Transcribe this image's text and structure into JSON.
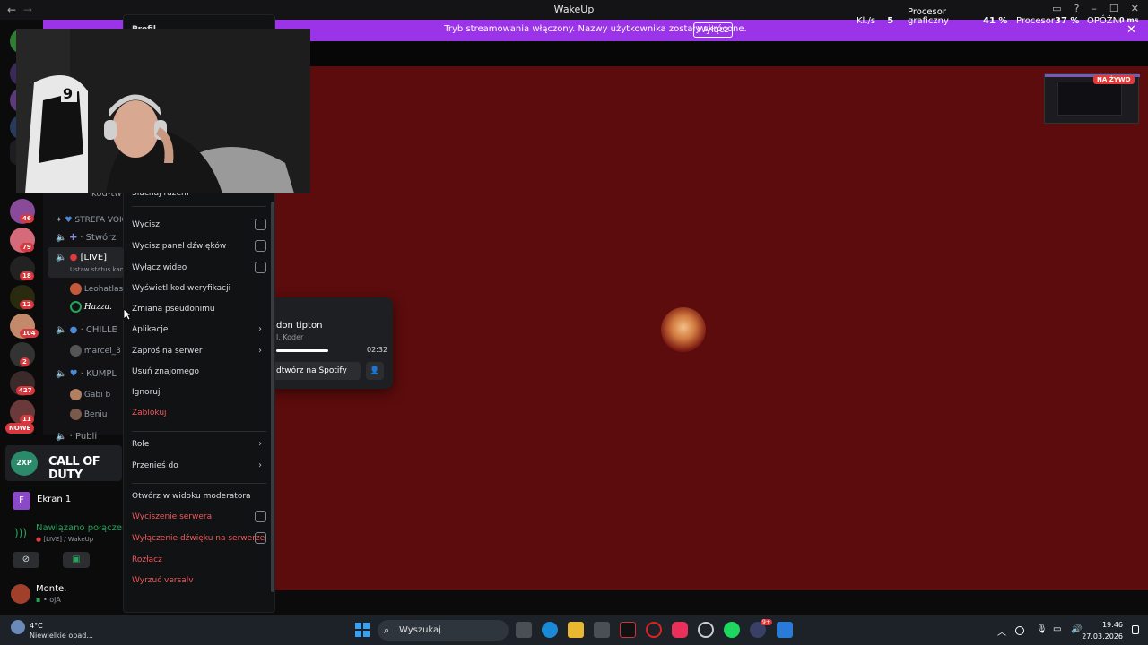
{
  "window": {
    "title": "WakeUp",
    "back": "←",
    "forward": "→",
    "minimize": "–",
    "maximize": "☐",
    "close": "✕",
    "help": "?"
  },
  "banner": {
    "text": "Tryb streamowania włączony. Nazwy użytkownika zostały skrócone.",
    "button": "Wyłącz",
    "close": "✕",
    "stats": {
      "fps_label": "Kl./s",
      "fps_value": "5",
      "gpu_label_1": "Procesor",
      "gpu_label_2": "graficzny",
      "gpu_value": "41 %",
      "cpu_label": "Procesor",
      "cpu_value": "37 %",
      "latency_label": "OPÓŹN.",
      "latency_value": "0 ms"
    }
  },
  "rail": {
    "badges": [
      "46",
      "79",
      "18",
      "12",
      "104",
      "2",
      "427",
      "11"
    ],
    "new_label": "NOWE"
  },
  "channels": {
    "items": [
      {
        "text": "kod-tw",
        "type": "text"
      },
      {
        "text": "STREFA VOICE",
        "type": "category"
      },
      {
        "text": "· Stwórz",
        "type": "voice"
      },
      {
        "text": "[LIVE]",
        "type": "voice-active"
      },
      {
        "text": "Ustaw status kan",
        "type": "sub"
      },
      {
        "text": "Leohatlas",
        "type": "member"
      },
      {
        "text": "Hazza.",
        "type": "member"
      },
      {
        "text": "· CHILLE",
        "type": "voice"
      },
      {
        "text": "marcel_3",
        "type": "member"
      },
      {
        "text": "· KUMPL",
        "type": "voice"
      },
      {
        "text": "Gabi b",
        "type": "member"
      },
      {
        "text": "Beniu",
        "type": "member"
      },
      {
        "text": "· Publi",
        "type": "voice"
      }
    ]
  },
  "game": {
    "name": "CALL OF DUTY",
    "badge": "2XP"
  },
  "screen_share": {
    "icon_letter": "F",
    "label": "Ekran 1"
  },
  "voice_status": {
    "title": "Nawiązano połączenie",
    "subtitle": "[LIVE] / WakeUp"
  },
  "user": {
    "name": "Monte.",
    "status": "ojA"
  },
  "context_menu": {
    "top_label": "Profil",
    "items": [
      {
        "label": "Słuchaj razem",
        "style": "normal",
        "control": "none"
      },
      {
        "label": "Wycisz",
        "style": "normal",
        "control": "checkbox"
      },
      {
        "label": "Wycisz panel dźwięków",
        "style": "normal",
        "control": "checkbox"
      },
      {
        "label": "Wyłącz wideo",
        "style": "normal",
        "control": "checkbox"
      },
      {
        "label": "Wyświetl kod weryfikacji",
        "style": "normal",
        "control": "none"
      },
      {
        "label": "Zmiana pseudonimu",
        "style": "normal",
        "control": "none"
      },
      {
        "label": "Aplikacje",
        "style": "normal",
        "control": "submenu"
      },
      {
        "label": "Zaproś na serwer",
        "style": "normal",
        "control": "submenu"
      },
      {
        "label": "Usuń znajomego",
        "style": "normal",
        "control": "none"
      },
      {
        "label": "Ignoruj",
        "style": "normal",
        "control": "none"
      },
      {
        "label": "Zablokuj",
        "style": "danger",
        "control": "none"
      },
      {
        "label": "Role",
        "style": "normal",
        "control": "submenu"
      },
      {
        "label": "Przenieś do",
        "style": "normal",
        "control": "submenu"
      },
      {
        "label": "Otwórz w widoku moderatora",
        "style": "normal",
        "control": "none"
      },
      {
        "label": "Wyciszenie serwera",
        "style": "danger",
        "control": "checkbox"
      },
      {
        "label": "Wyłączenie dźwięku na serwerze",
        "style": "danger",
        "control": "checkbox"
      },
      {
        "label": "Rozłącz",
        "style": "danger",
        "control": "none"
      },
      {
        "label": "Wyrzuć versalv",
        "style": "danger",
        "control": "none"
      }
    ]
  },
  "spotify": {
    "track": "don tipton",
    "artist": "l, Koder",
    "time": "02:32",
    "progress": 0.6,
    "open_button": "dtwórz na Spotify"
  },
  "live_preview": {
    "badge": "NA ŻYWO"
  },
  "taskbar": {
    "weather_temp": "4°C",
    "weather_desc": "Niewielkie opad...",
    "search_placeholder": "Wyszukaj",
    "time": "19:46",
    "date": "27.03.2026",
    "discord_badge": "9+"
  },
  "colors": {
    "banner": "#9b33e8",
    "stage": "#5c0c0c",
    "danger": "#f2585b",
    "menu": "#111214"
  }
}
